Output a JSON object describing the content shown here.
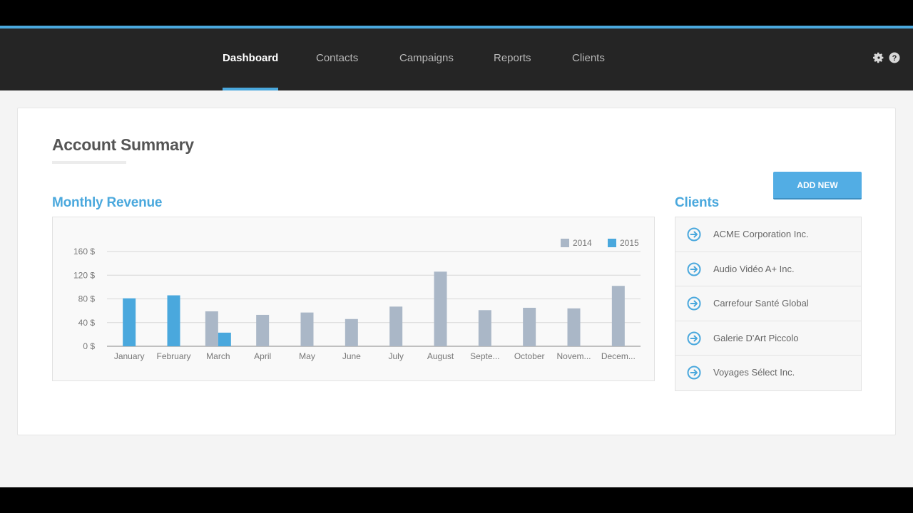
{
  "nav": {
    "items": [
      {
        "label": "Dashboard",
        "active": true
      },
      {
        "label": "Contacts",
        "active": false
      },
      {
        "label": "Campaigns",
        "active": false
      },
      {
        "label": "Reports",
        "active": false
      },
      {
        "label": "Clients",
        "active": false
      }
    ],
    "icons": [
      "gear-icon",
      "help-icon"
    ]
  },
  "page": {
    "title": "Account Summary"
  },
  "revenue": {
    "title": "Monthly Revenue"
  },
  "clients": {
    "title": "Clients",
    "add_label": "ADD NEW",
    "items": [
      "ACME Corporation Inc.",
      "Audio Vidéo A+ Inc.",
      "Carrefour Santé Global",
      "Galerie D'Art Piccolo",
      "Voyages Sélect Inc."
    ]
  },
  "colors": {
    "accent": "#4aa8dd",
    "series_2014": "#aab7c7",
    "series_2015": "#4aa8dd",
    "nav_bg": "#252525"
  },
  "chart_data": {
    "type": "bar",
    "categories": [
      "January",
      "February",
      "March",
      "April",
      "May",
      "June",
      "July",
      "August",
      "Septe...",
      "October",
      "Novem...",
      "Decem..."
    ],
    "series": [
      {
        "name": "2014",
        "values": [
          null,
          null,
          59,
          53,
          57,
          46,
          67,
          126,
          61,
          65,
          64,
          102
        ]
      },
      {
        "name": "2015",
        "values": [
          81,
          86,
          23,
          null,
          null,
          null,
          null,
          null,
          null,
          null,
          null,
          null
        ]
      }
    ],
    "yticks": [
      "0 $",
      "40 $",
      "80 $",
      "120 $",
      "160 $"
    ],
    "ytick_values": [
      0,
      40,
      80,
      120,
      160
    ],
    "ylim": [
      0,
      160
    ],
    "legend": [
      "2014",
      "2015"
    ],
    "legend_position": "top-right",
    "grid": true
  }
}
